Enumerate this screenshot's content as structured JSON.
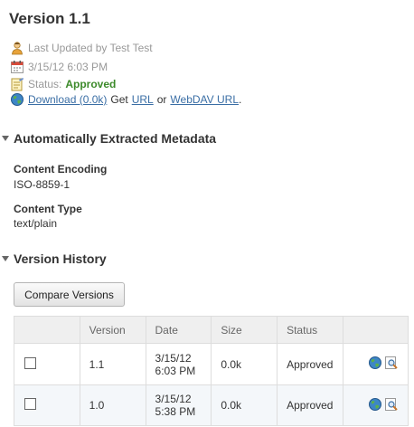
{
  "page": {
    "title": "Version 1.1"
  },
  "info": {
    "last_updated": "Last Updated by Test Test",
    "date": "3/15/12 6:03 PM",
    "status_label": "Status:",
    "status_value": "Approved",
    "download_link": "Download (0.0k)",
    "get_text": "Get",
    "url_link": "URL",
    "or_text": "or",
    "webdav_link": "WebDAV URL",
    "period": "."
  },
  "metadata_section": {
    "title": "Automatically Extracted Metadata",
    "fields": [
      {
        "label": "Content Encoding",
        "value": "ISO-8859-1"
      },
      {
        "label": "Content Type",
        "value": "text/plain"
      }
    ]
  },
  "history_section": {
    "title": "Version History",
    "compare_button": "Compare Versions",
    "columns": [
      "",
      "Version",
      "Date",
      "Size",
      "Status",
      ""
    ],
    "rows": [
      {
        "version": "1.1",
        "date_line1": "3/15/12",
        "date_line2": "6:03 PM",
        "size": "0.0k",
        "status": "Approved"
      },
      {
        "version": "1.0",
        "date_line1": "3/15/12",
        "date_line2": "5:38 PM",
        "size": "0.0k",
        "status": "Approved"
      }
    ]
  },
  "colors": {
    "status_approved": "#3c8a2a",
    "link": "#3a6ea5",
    "muted_text": "#999999",
    "header_bg": "#efefef",
    "alt_row_bg": "#f4f7fa"
  },
  "icons": [
    "user-icon",
    "calendar-icon",
    "status-note-icon",
    "globe-icon",
    "globe-icon",
    "magnifier-icon"
  ]
}
